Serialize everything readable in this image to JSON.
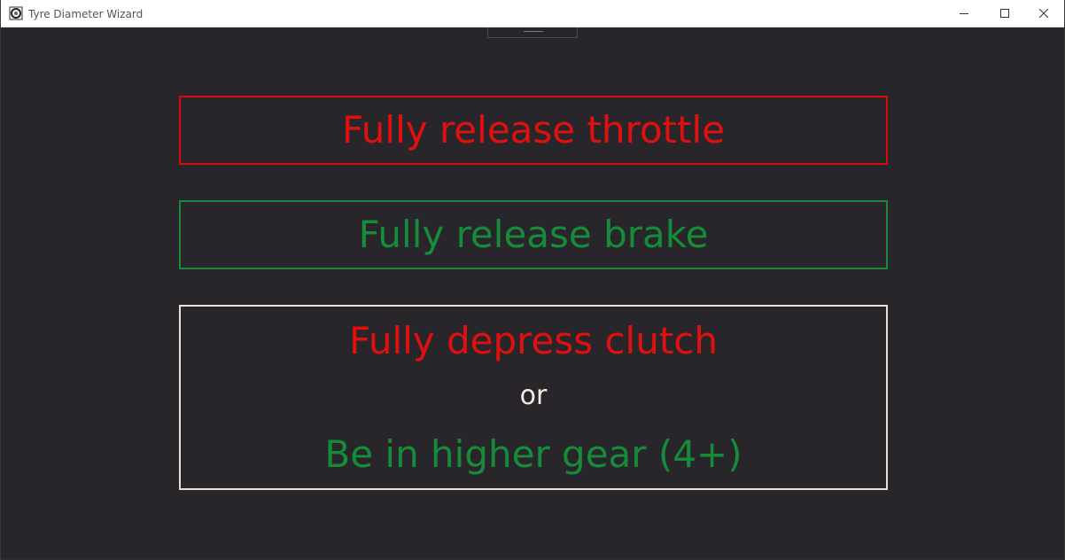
{
  "window": {
    "title": "Tyre Diameter Wizard",
    "icons": {
      "app": "tyre-app-icon",
      "minimize": "minimize-icon",
      "maximize": "maximize-icon",
      "close": "close-icon"
    }
  },
  "instructions": {
    "throttle": "Fully release throttle",
    "brake": "Fully release brake",
    "clutch": "Fully depress clutch",
    "or": "or",
    "gear": "Be in higher gear (4+)"
  },
  "colors": {
    "background": "#28262b",
    "red": "#e0100f",
    "green": "#168c3a",
    "neutral": "#f2ecdf"
  }
}
